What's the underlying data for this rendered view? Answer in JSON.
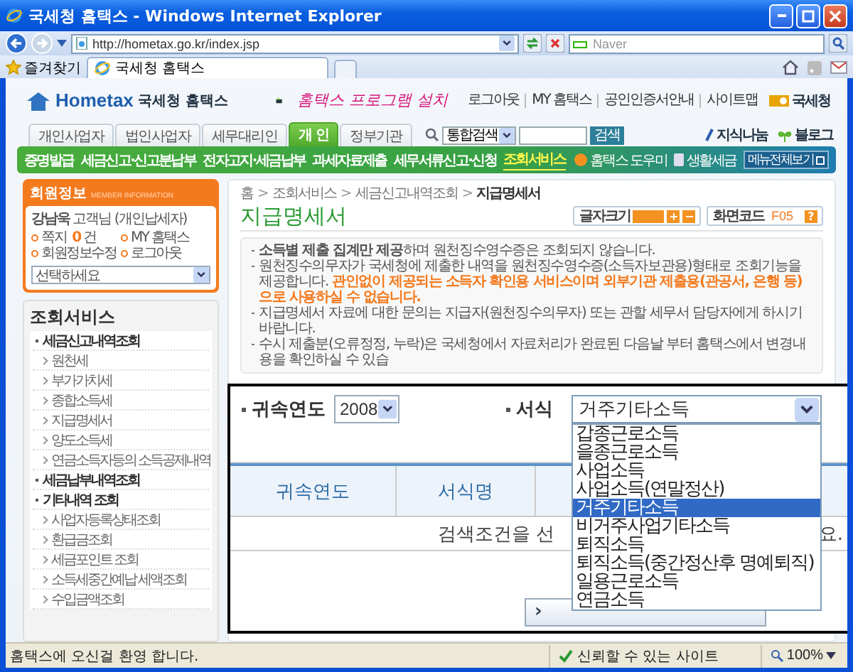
{
  "window": {
    "title": "국세청 홈택스 - Windows Internet Explorer"
  },
  "address_bar": {
    "url": "http://hometax.go.kr/index.jsp"
  },
  "search_box": {
    "placeholder": "Naver"
  },
  "favorites": {
    "label": "즐겨찾기"
  },
  "browser_tabs": [
    {
      "label": "국세청 홈택스",
      "selected": true
    }
  ],
  "site": {
    "logo_text": "Hometax",
    "logo_caption": "국세청 홈택스",
    "banner": "홈택스 프로그램 설치",
    "top_links": [
      "로그아웃",
      "MY 홈택스",
      "공인인증서안내",
      "사이트맵",
      "국세청"
    ],
    "user_tabs": [
      {
        "label": "개인사업자",
        "selected": false
      },
      {
        "label": "법인사업자",
        "selected": false
      },
      {
        "label": "세무대리인",
        "selected": false
      },
      {
        "label": "개 인",
        "selected": true
      },
      {
        "label": "정부기관",
        "selected": false
      }
    ],
    "search": {
      "scope": "통합검색",
      "button": "검색"
    },
    "side_links": [
      "지식나눔",
      "블로그"
    ],
    "menu": [
      {
        "label": "증명발급",
        "selected": false
      },
      {
        "label": "세금신고·신고분납부",
        "selected": false
      },
      {
        "label": "전자고지·세금납부",
        "selected": false
      },
      {
        "label": "과세자료제출",
        "selected": false
      },
      {
        "label": "세무서류신고·신청",
        "selected": false
      },
      {
        "label": "조회서비스",
        "selected": true
      }
    ],
    "menu_tools": [
      "홈택스 도우미",
      "생활세금",
      "메뉴전체보기"
    ]
  },
  "member": {
    "title": "회원정보",
    "subtitle": "MEMBER INFORMATION",
    "greeting": "**강남욱** 고객님 (개인납세자)",
    "links": [
      {
        "label": "쪽지",
        "count": "0",
        "unit": "건"
      },
      {
        "label": "MY 홈택스"
      },
      {
        "label": "회원정보수정"
      },
      {
        "label": "로그아웃"
      }
    ],
    "select": "선택하세요"
  },
  "sidebar": {
    "title": "조회서비스",
    "items": [
      {
        "label": "세금신고내역조회",
        "children": [
          {
            "label": "원천세"
          },
          {
            "label": "부가가치세"
          },
          {
            "label": "종합소득세"
          },
          {
            "label": "지급명세서"
          },
          {
            "label": "양도소득세"
          },
          {
            "label": "연금소득자등의 소득공제내역"
          }
        ]
      },
      {
        "label": "세금납부내역조회"
      },
      {
        "label": "기타내역 조회",
        "children": [
          {
            "label": "사업자등록상태조회"
          },
          {
            "label": "환급금조회"
          },
          {
            "label": "세금포인트 조회"
          },
          {
            "label": "소득세중간예납 세액조회"
          },
          {
            "label": "수입금액조회"
          }
        ]
      }
    ]
  },
  "main": {
    "breadcrumb": [
      "홈",
      "조회서비스",
      "세금신고내역조회"
    ],
    "separator": ">",
    "current": "지급명세서",
    "title": "지급명세서",
    "font_size": {
      "label": "글자크기",
      "increase": "+",
      "decrease": "−"
    },
    "screen_code": {
      "label": "화면코드",
      "code": "F05",
      "help": "?"
    },
    "notices": [
      {
        "text": "**소득별 제출 집계만 제공**하며 원천징수영수증은 조회되지 않습니다."
      },
      {
        "text": "원천징수의무자가 국세청에 제출한 내역을 원천징수영수증(소득자보관용)형태로 조회기능을 제공합니다. ",
        "highlight": "관인없이 제공되는 소득자 확인용 서비스이며 외부기관 제출용(관공서, 은행 등)으로 사용하실 수 없습니다."
      },
      {
        "text": "지급명세서 자료에 대한 문의는 지급자(원천징수의무자) 또는 관할 세무서 담당자에게 하시기 바랍니다."
      },
      {
        "text": "수시 제출분(오류정정, 누락)은 국세청에서 자료처리가 완료된 다음날 부터 홈택스에서 변경내용을 확인하실 수 있습"
      }
    ]
  },
  "zoom_inset": {
    "year": {
      "label": "귀속연도",
      "value": "2008"
    },
    "form": {
      "label": "서식",
      "value": "거주기타소득",
      "expanded": true,
      "options": [
        {
          "label": "갑종근로소득",
          "selected": false
        },
        {
          "label": "을종근로소득",
          "selected": false
        },
        {
          "label": "사업소득",
          "selected": false
        },
        {
          "label": "사업소득(연말정산)",
          "selected": false
        },
        {
          "label": "거주기타소득",
          "selected": true
        },
        {
          "label": "비거주사업기타소득",
          "selected": false
        },
        {
          "label": "퇴직소득",
          "selected": false
        },
        {
          "label": "퇴직소득(중간정산후 명예퇴직)",
          "selected": false
        },
        {
          "label": "일용근로소득",
          "selected": false
        },
        {
          "label": "연금소득",
          "selected": false
        }
      ]
    },
    "columns": [
      "귀속연도",
      "서식명"
    ],
    "message": {
      "start": "검색조건을 선",
      "end": "요."
    },
    "button": "›"
  },
  "status_bar": {
    "text": "홈택스에 오신걸 환영 합니다.",
    "zone": "신뢰할 수 있는 사이트",
    "zoom": "100%"
  }
}
